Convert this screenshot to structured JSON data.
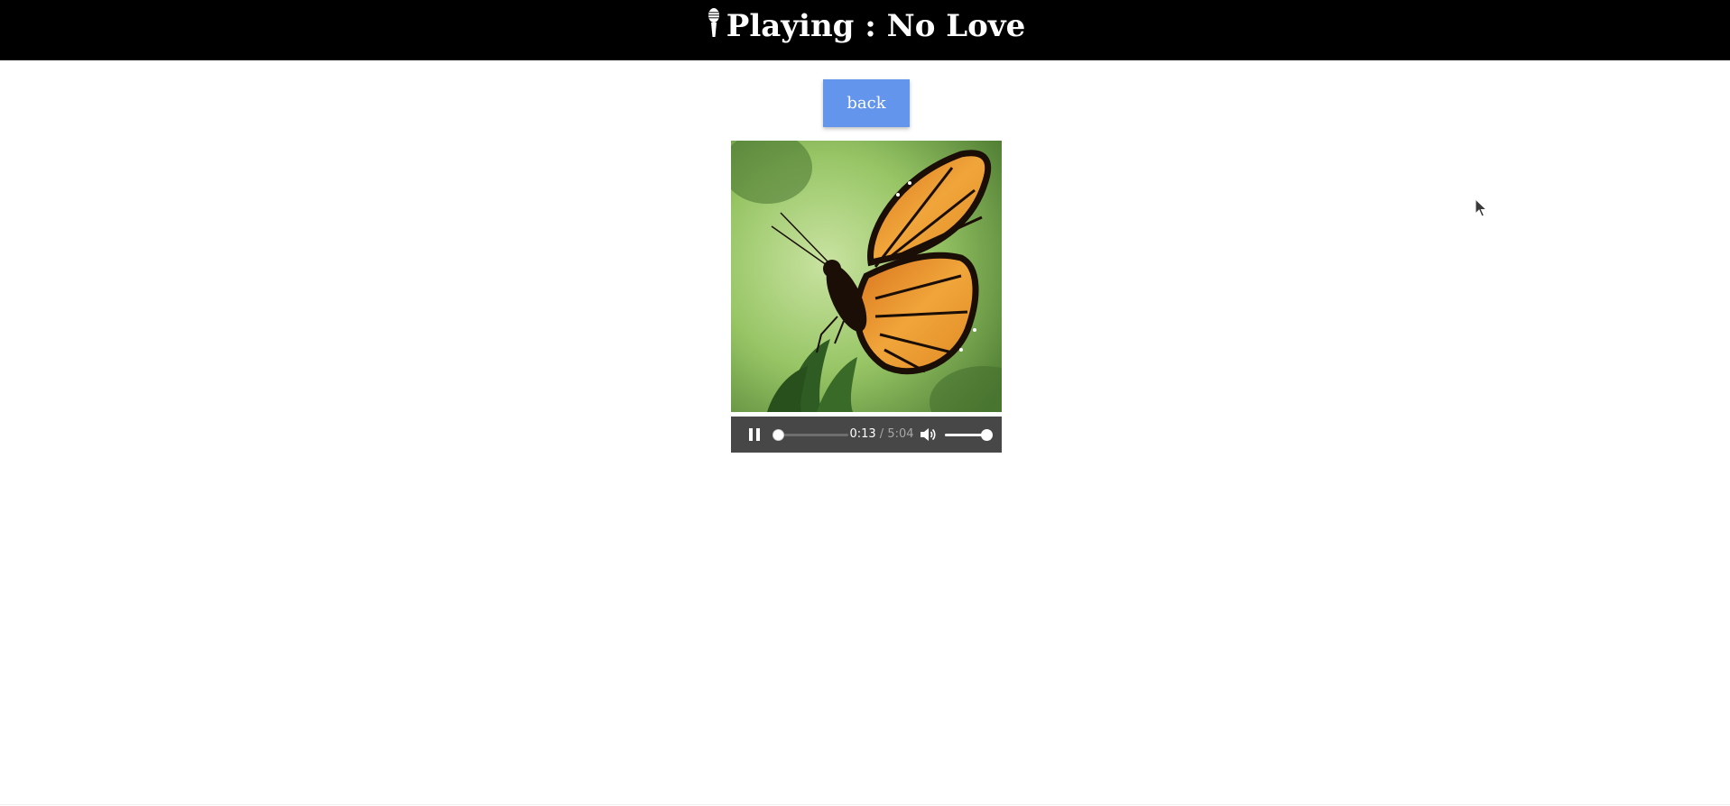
{
  "header": {
    "title": "Playing : No Love",
    "icon": "microphone-icon"
  },
  "back_button": {
    "label": "back"
  },
  "cover": {
    "icon": "butterfly-artwork"
  },
  "player": {
    "state": "playing",
    "current_time": "0:13",
    "separator": " / ",
    "total_time": "5:04",
    "progress_fraction": 0.043,
    "volume_fraction": 1.0,
    "icons": {
      "play_pause": "pause-icon",
      "volume": "volume-icon"
    }
  },
  "colors": {
    "header_bg": "#000000",
    "button_bg": "#6495ed",
    "player_bg": "#474747"
  }
}
